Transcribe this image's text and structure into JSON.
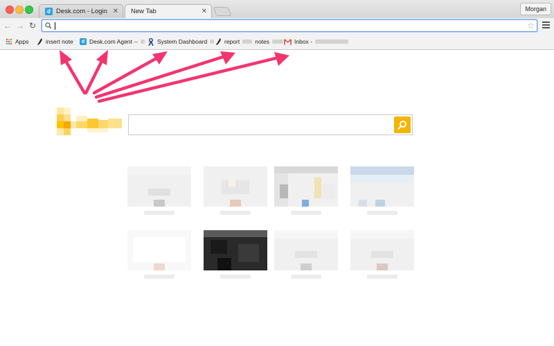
{
  "window": {
    "profile_name": "Morgan"
  },
  "tabs": [
    {
      "label": "Desk.com - Login",
      "active": false,
      "favicon": "desk-favicon"
    },
    {
      "label": "New Tab",
      "active": true
    }
  ],
  "toolbar": {
    "omnibox_value": "",
    "icons": [
      "back-arrow-icon",
      "forward-arrow-icon",
      "reload-icon",
      "search-icon",
      "star-icon",
      "hamburger-menu-icon"
    ]
  },
  "bookmarks": [
    {
      "label": "Apps",
      "icon": "apps-grid-icon"
    },
    {
      "label": "insert note",
      "icon": "quill-icon"
    },
    {
      "label": "Desk.com Agent -- ",
      "icon": "desk-favicon"
    },
    {
      "label": "System Dashboard",
      "icon": "dashboard-icon"
    },
    {
      "label": "report",
      "label_suffix": "notes",
      "icon": "quill-icon"
    },
    {
      "label": "Inbox - ",
      "icon": "gmail-icon"
    }
  ],
  "page": {
    "search_placeholder": "",
    "search_button_icon": "search-icon",
    "tile_count": 8
  },
  "colors": {
    "annotation_arrow": "#f2356f",
    "search_button": "#f5b400",
    "logo": "#fcc400"
  }
}
